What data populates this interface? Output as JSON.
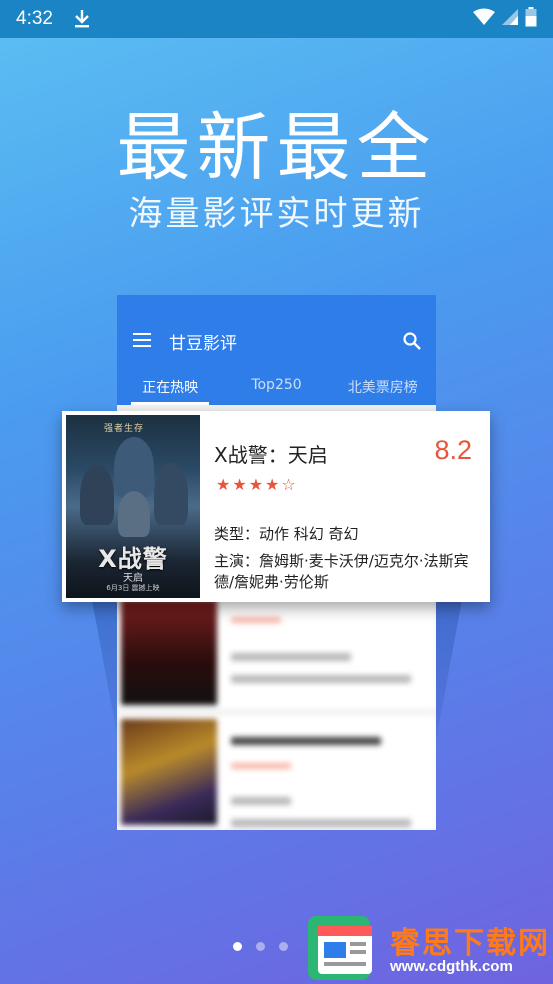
{
  "status_bar": {
    "time": "4:32"
  },
  "hero": {
    "title": "最新最全",
    "subtitle": "海量影评实时更新"
  },
  "app": {
    "title": "甘豆影评",
    "tabs": [
      {
        "label": "正在热映",
        "active": true
      },
      {
        "label": "Top250",
        "active": false
      },
      {
        "label": "北美票房榜",
        "active": false
      }
    ]
  },
  "featured_movie": {
    "title": "X战警：天启",
    "score": "8.2",
    "stars": "★★★★☆",
    "genre": "类型：动作 科幻 奇幻",
    "cast": "主演：詹姆斯·麦卡沃伊/迈克尔·法斯宾德/詹妮弗·劳伦斯",
    "poster": {
      "tagline": "强者生存",
      "logo": "X战警",
      "subtitle": "天启",
      "date": "6月3日 震撼上映"
    }
  },
  "pager": {
    "count": 3,
    "active_index": 0
  },
  "watermark": {
    "name": "睿思下载网",
    "url": "www.cdgthk.com"
  },
  "colors": {
    "accent": "#2f7de9",
    "score": "#e8553c",
    "status_bar": "#1a84c4",
    "watermark": "#ff7a1a"
  }
}
